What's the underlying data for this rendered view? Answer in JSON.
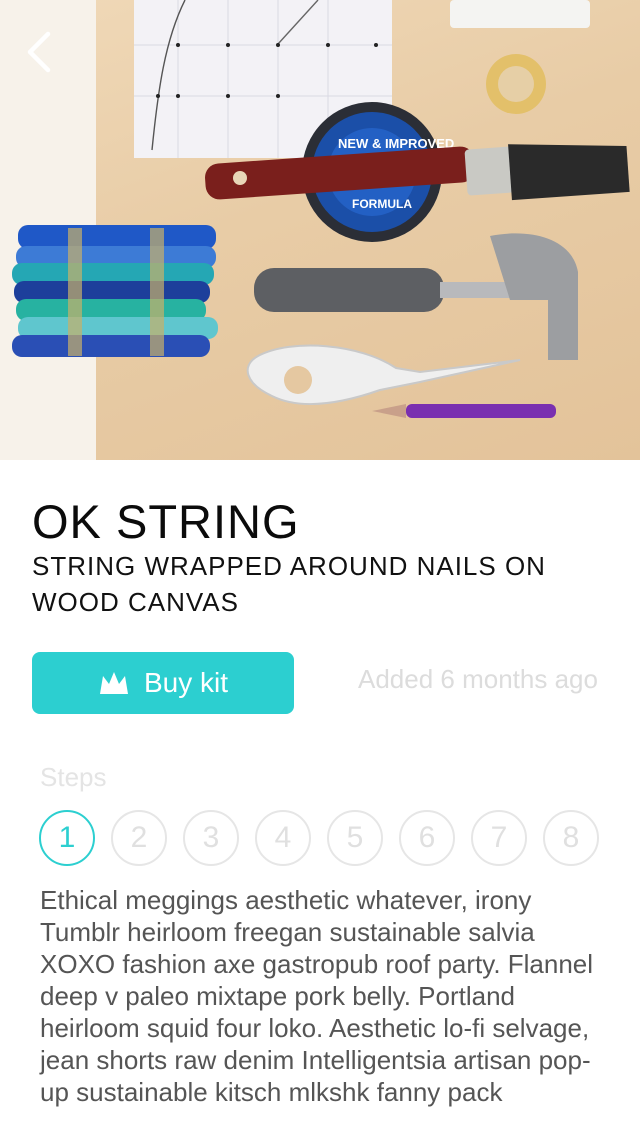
{
  "nav": {
    "back_icon": "chevron-left-icon"
  },
  "project": {
    "title": "OK STRING",
    "subtitle": "STRING WRAPPED AROUND NAILS ON WOOD CANVAS",
    "buy_label": "Buy kit",
    "buy_icon": "crown-icon",
    "added": "Added 6 months ago",
    "accent": "#2ccfd0"
  },
  "steps": {
    "label": "Steps",
    "items": [
      "1",
      "2",
      "3",
      "4",
      "5",
      "6",
      "7",
      "8"
    ],
    "active": "1"
  },
  "description": "Ethical meggings aesthetic whatever, irony Tumblr heirloom freegan sustainable salvia XOXO fashion axe gastropub roof party. Flannel deep v paleo mixtape pork belly. Portland heirloom squid four loko. Aesthetic lo-fi selvage, jean shorts raw denim Intelligentsia artisan pop-up sustainable kitsch mlkshk fanny pack"
}
